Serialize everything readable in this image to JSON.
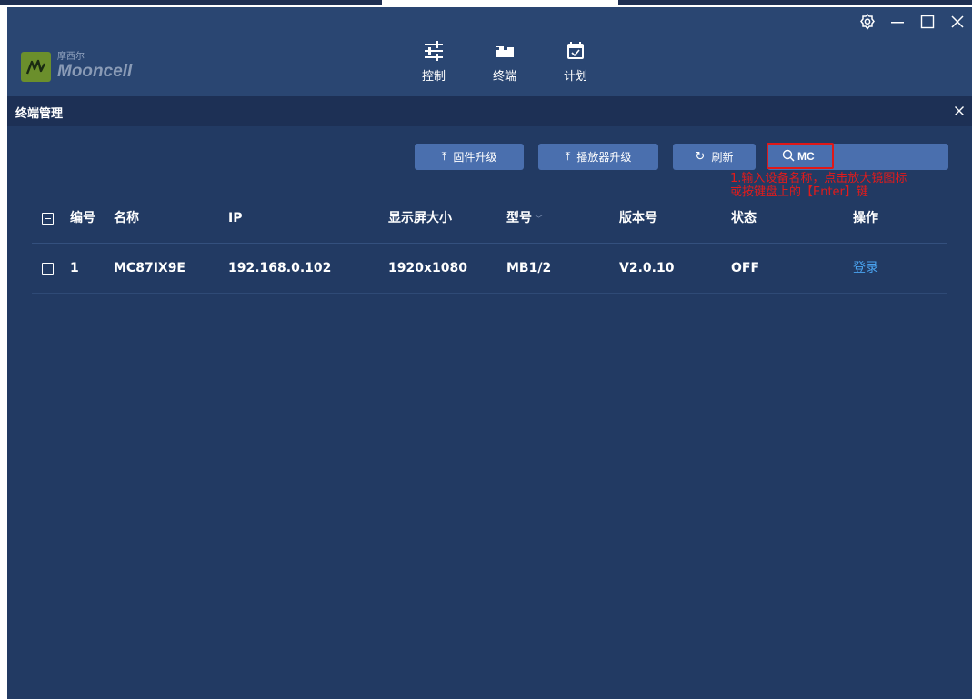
{
  "app": {
    "brand_cn": "摩西尔",
    "brand_en": "Mooncell"
  },
  "nav": [
    {
      "label": "控制",
      "icon": "sliders-icon"
    },
    {
      "label": "终端",
      "icon": "terminal-icon"
    },
    {
      "label": "计划",
      "icon": "calendar-icon"
    }
  ],
  "window_controls": [
    "settings-icon",
    "minimize-icon",
    "maximize-icon",
    "close-icon"
  ],
  "panel": {
    "title": "终端管理"
  },
  "toolbar": {
    "firmware_label": "固件升级",
    "player_label": "播放器升级",
    "refresh_label": "刷新",
    "search_value": "MC",
    "search_placeholder": ""
  },
  "annotation": {
    "line1": "1.输入设备名称，点击放大镜图标",
    "line2": "或按键盘上的【Enter】键"
  },
  "table": {
    "headers": {
      "no": "编号",
      "name": "名称",
      "ip": "IP",
      "size": "显示屏大小",
      "type": "型号",
      "version": "版本号",
      "status": "状态",
      "action": "操作"
    },
    "rows": [
      {
        "no": "1",
        "name": "MC87IX9E",
        "ip": "192.168.0.102",
        "size": "1920x1080",
        "type": "MB1/2",
        "version": "V2.0.10",
        "status": "OFF",
        "action": "登录"
      }
    ]
  },
  "colors": {
    "background": "#223a63",
    "header": "#2a4672",
    "button": "#4a6fae",
    "highlight": "#e01818",
    "link": "#4aa3f0"
  }
}
